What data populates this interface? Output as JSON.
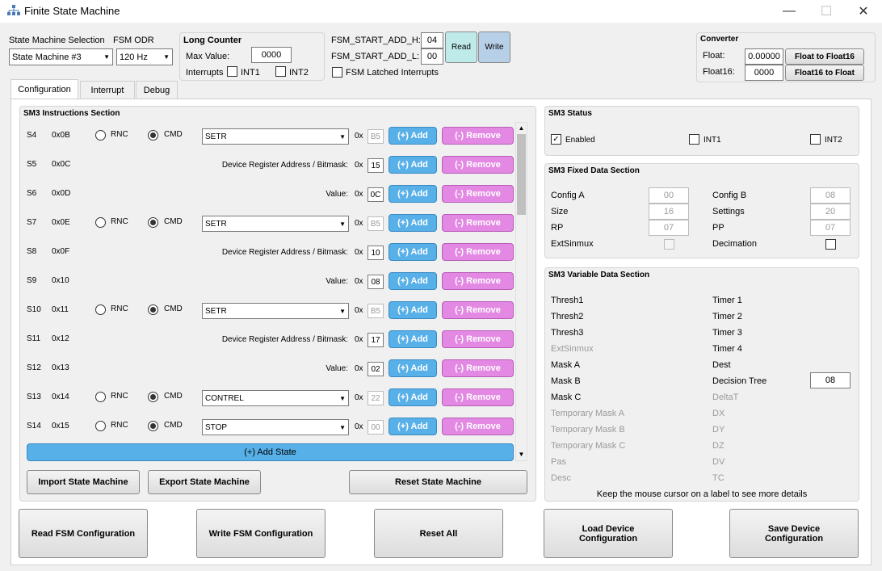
{
  "window": {
    "title": "Finite State Machine",
    "minimize": "—",
    "maximize": "☐",
    "close": "✕"
  },
  "sm_select": {
    "label": "State Machine Selection",
    "value": "State Machine #3"
  },
  "odr": {
    "label": "FSM ODR",
    "value": "120 Hz"
  },
  "long_counter": {
    "title": "Long Counter",
    "max_label": "Max Value:",
    "max_value": "0000",
    "interrupts_label": "Interrupts",
    "int1": "INT1",
    "int2": "INT2"
  },
  "fsm_start": {
    "h_label": "FSM_START_ADD_H:",
    "h_value": "04",
    "l_label": "FSM_START_ADD_L:",
    "l_value": "00",
    "read": "Read",
    "write": "Write",
    "latched": "FSM Latched Interrupts"
  },
  "converter": {
    "title": "Converter",
    "float_label": "Float:",
    "float_value": "0.00000",
    "float16_label": "Float16:",
    "float16_value": "0000",
    "to_f16": "Float to Float16",
    "to_f": "Float16 to Float"
  },
  "tabs": [
    "Configuration",
    "Interrupt",
    "Debug"
  ],
  "instructions": {
    "title": "SM3 Instructions Section",
    "rnc": "RNC",
    "cmd": "CMD",
    "ox": "0x",
    "add": "(+) Add",
    "remove": "(-) Remove",
    "rows": [
      {
        "s": "S4",
        "addr": "0x0B",
        "type": "cmd",
        "cmd": "SETR",
        "hex": "B5"
      },
      {
        "s": "S5",
        "addr": "0x0C",
        "type": "param",
        "label": "Device Register Address / Bitmask:",
        "hex": "15"
      },
      {
        "s": "S6",
        "addr": "0x0D",
        "type": "param",
        "label": "Value:",
        "hex": "0C"
      },
      {
        "s": "S7",
        "addr": "0x0E",
        "type": "cmd",
        "cmd": "SETR",
        "hex": "B5"
      },
      {
        "s": "S8",
        "addr": "0x0F",
        "type": "param",
        "label": "Device Register Address / Bitmask:",
        "hex": "10"
      },
      {
        "s": "S9",
        "addr": "0x10",
        "type": "param",
        "label": "Value:",
        "hex": "08"
      },
      {
        "s": "S10",
        "addr": "0x11",
        "type": "cmd",
        "cmd": "SETR",
        "hex": "B5"
      },
      {
        "s": "S11",
        "addr": "0x12",
        "type": "param",
        "label": "Device Register Address / Bitmask:",
        "hex": "17"
      },
      {
        "s": "S12",
        "addr": "0x13",
        "type": "param",
        "label": "Value:",
        "hex": "02"
      },
      {
        "s": "S13",
        "addr": "0x14",
        "type": "cmd",
        "cmd": "CONTREL",
        "hex": "22"
      },
      {
        "s": "S14",
        "addr": "0x15",
        "type": "cmd",
        "cmd": "STOP",
        "hex": "00"
      }
    ],
    "add_state": "(+) Add State",
    "import": "Import State Machine",
    "export": "Export State Machine",
    "reset": "Reset State Machine"
  },
  "status": {
    "title": "SM3 Status",
    "enabled": "Enabled",
    "int1": "INT1",
    "int2": "INT2"
  },
  "fixed": {
    "title": "SM3 Fixed Data Section",
    "left": [
      {
        "label": "Config A",
        "value": "00"
      },
      {
        "label": "Size",
        "value": "16"
      },
      {
        "label": "RP",
        "value": "07"
      }
    ],
    "right": [
      {
        "label": "Config B",
        "value": "08"
      },
      {
        "label": "Settings",
        "value": "20"
      },
      {
        "label": "PP",
        "value": "07"
      }
    ],
    "extsinmux": "ExtSinmux",
    "decimation": "Decimation"
  },
  "variable": {
    "title": "SM3 Variable Data Section",
    "left": [
      "Thresh1",
      "Thresh2",
      "Thresh3",
      "ExtSinmux",
      "Mask A",
      "Mask B",
      "Mask C",
      "Temporary Mask A",
      "Temporary Mask B",
      "Temporary Mask C",
      "Pas",
      "Desc"
    ],
    "right": [
      "Timer 1",
      "Timer 2",
      "Timer 3",
      "Timer 4",
      "Dest",
      "Decision Tree",
      "DeltaT",
      "DX",
      "DY",
      "DZ",
      "DV",
      "TC"
    ],
    "decision_tree_value": "08",
    "hint": "Keep the mouse cursor on a label to see more details"
  },
  "bottom": {
    "read": "Read FSM Configuration",
    "write": "Write FSM Configuration",
    "reset": "Reset All",
    "load": "Load Device Configuration",
    "save": "Save Device Configuration"
  }
}
